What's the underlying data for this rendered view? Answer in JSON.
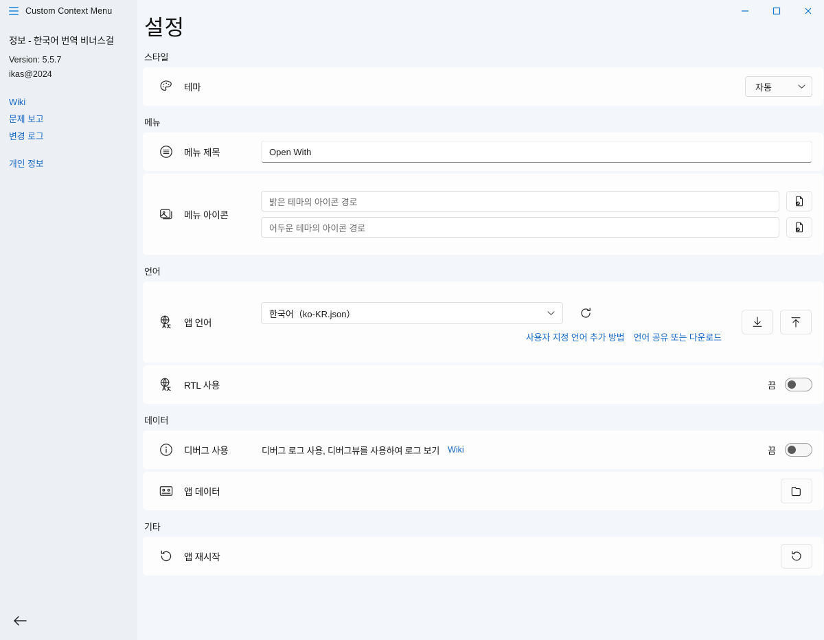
{
  "window": {
    "app_title": "Custom Context Menu",
    "menu_icon": "hamburger-icon",
    "minimize_label": "—",
    "maximize_label": "□",
    "close_label": "✕"
  },
  "sidebar": {
    "about_heading": "정보 - 한국어 번역 비너스걸",
    "version": "Version: 5.5.7",
    "author": "ikas@2024",
    "links": [
      {
        "label": "Wiki",
        "name": "sidebar-link-wiki"
      },
      {
        "label": "문제 보고",
        "name": "sidebar-link-report-issue"
      },
      {
        "label": "변경 로그",
        "name": "sidebar-link-changelog"
      }
    ],
    "privacy_link": "개인 정보",
    "back_icon": "arrow-left-icon"
  },
  "main": {
    "page_title": "설정",
    "sections": {
      "style": {
        "label": "스타일",
        "theme": {
          "icon": "palette-icon",
          "label": "테마",
          "value": "자동",
          "chevron": "⌄"
        }
      },
      "menu": {
        "label": "메뉴",
        "menu_title": {
          "icon": "list-circle-icon",
          "label": "메뉴 제목",
          "value": "Open With"
        },
        "menu_icon": {
          "icon": "image-icon",
          "label": "메뉴 아이콘",
          "light_placeholder": "밝은 테마의 아이콘 경로",
          "light_value": "",
          "dark_placeholder": "어두운 테마의 아이콘 경로",
          "dark_value": "",
          "browse_icon": "file-open-icon"
        }
      },
      "language": {
        "label": "언어",
        "app_language": {
          "icon": "globe-translate-icon",
          "label": "앱 언어",
          "value": "한국어（ko-KR.json）",
          "chevron": "⌄",
          "refresh_icon": "refresh-icon",
          "download_icon": "download-icon",
          "upload_icon": "upload-icon",
          "link_add": "사용자 지정 언어 추가 방법",
          "link_share": "언어 공유 또는 다운로드"
        },
        "rtl": {
          "icon": "globe-translate-icon",
          "label": "RTL 사용",
          "state": "끔",
          "on": false
        }
      },
      "data": {
        "label": "데이터",
        "debug": {
          "icon": "info-circle-icon",
          "label": "디버그 사용",
          "description": "디버그 로그 사용, 디버그뷰를 사용하여 로그 보기",
          "wiki_link": "Wiki",
          "state": "끔",
          "on": false
        },
        "app_data": {
          "icon": "cassette-icon",
          "label": "앱 데이터",
          "folder_icon": "folder-icon"
        }
      },
      "other": {
        "label": "기타",
        "restart": {
          "icon": "restart-icon",
          "label": "앱 재시작",
          "button_icon": "restart-icon"
        }
      }
    }
  },
  "colors": {
    "accent_link": "#1668c4",
    "content_bg": "#f3f6fa",
    "sidebar_bg": "#eceff3",
    "card_bg": "#fdfdfd",
    "window_control": "#1668c4"
  }
}
